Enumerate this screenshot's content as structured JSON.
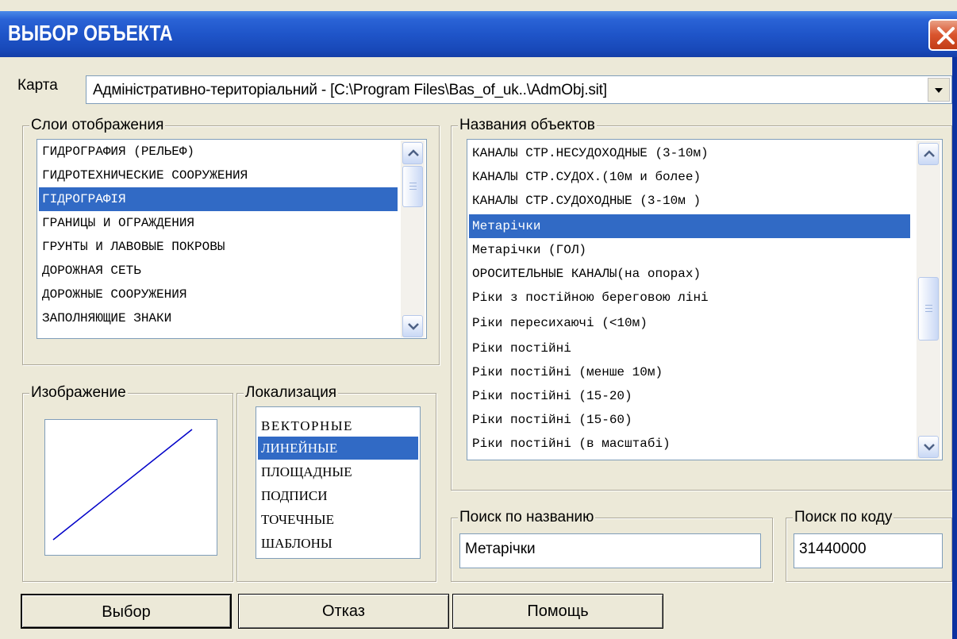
{
  "window": {
    "title": "ВЫБОР ОБЪЕКТА",
    "close_icon": "close-icon"
  },
  "map": {
    "label": "Карта",
    "value": "Адміністративно-територіальний - [C:\\Program Files\\Bas_of_uk..\\AdmObj.sit]"
  },
  "layers": {
    "title": "Слои отображения",
    "items": [
      "ГИДРОГРАФИЯ (РЕЛЬЕФ)",
      "ГИДРОТЕХНИЧЕСКИЕ СООРУЖЕНИЯ",
      "ГІДРОГРАФІЯ",
      "ГРАНИЦЫ И ОГРАЖДЕНИЯ",
      "ГРУНТЫ И ЛАВОВЫЕ ПОКРОВЫ",
      "ДОРОЖНАЯ СЕТЬ",
      "ДОРОЖНЫЕ СООРУЖЕНИЯ",
      "ЗАПОЛНЯЮЩИЕ ЗНАКИ"
    ],
    "selected": "ГІДРОГРАФІЯ"
  },
  "objects": {
    "title": "Названия объектов",
    "items": [
      "КАНАЛЫ СТР.НЕСУДОХОДНЫЕ (3-10м)",
      "КАНАЛЫ СТР.СУДОХ.(10м и более)",
      "КАНАЛЫ СТР.СУДОХОДНЫЕ (3-10м )",
      "Метарічки",
      "Метарічки (ГОЛ)",
      "ОРОСИТЕЛЬНЫЕ КАНАЛЫ(на опорах)",
      "Ріки з постійною береговою ліні",
      "Ріки пересихаючі (<10м)",
      "Ріки постійні",
      "Ріки постійні  (менше 10м)",
      "Ріки постійні (15-20)",
      "Ріки постійні (15-60)",
      "Ріки постійні (в масштабі)"
    ],
    "selected": "Метарічки"
  },
  "image": {
    "title": "Изображение",
    "line_color": "#0000c8"
  },
  "localization": {
    "title": "Локализация",
    "items": [
      "ВЕКТОРНЫЕ",
      "ЛИНЕЙНЫЕ",
      "ПЛОЩАДНЫЕ",
      "ПОДПИСИ",
      "ТОЧЕЧНЫЕ",
      "ШАБЛОНЫ"
    ],
    "selected": "ЛИНЕЙНЫЕ"
  },
  "search_name": {
    "title": "Поиск  по названию",
    "value": "Метарічки"
  },
  "search_code": {
    "title": "Поиск по коду",
    "value": "31440000"
  },
  "buttons": {
    "select": "Выбор",
    "cancel": "Отказ",
    "help": "Помощь"
  },
  "colors": {
    "titlebar": "#1f55c9",
    "selection": "#316ac5",
    "face": "#ece9d8",
    "close": "#d9542d"
  }
}
